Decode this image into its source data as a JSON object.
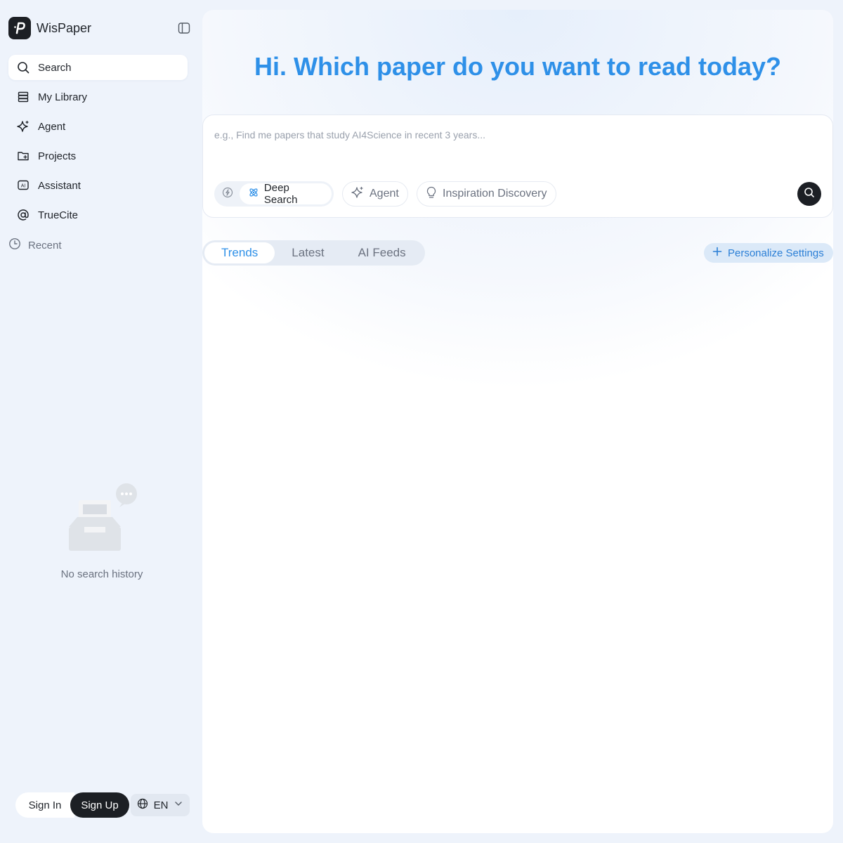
{
  "brand": {
    "name": "WisPaper",
    "logo_letter": "P"
  },
  "sidebar": {
    "items": [
      {
        "label": "Search",
        "icon": "search-icon",
        "active": true
      },
      {
        "label": "My Library",
        "icon": "library-icon"
      },
      {
        "label": "Agent",
        "icon": "sparkle-icon"
      },
      {
        "label": "Projects",
        "icon": "folder-plus-icon"
      },
      {
        "label": "Assistant",
        "icon": "ai-icon"
      },
      {
        "label": "TrueCite",
        "icon": "at-icon"
      }
    ],
    "recent_label": "Recent",
    "empty_text": "No search history"
  },
  "auth": {
    "signin": "Sign In",
    "signup": "Sign Up",
    "language": "EN"
  },
  "main": {
    "headline": "Hi. Which paper do you want to read today?",
    "search": {
      "placeholder": "e.g., Find me papers that study AI4Science in recent 3 years...",
      "value": ""
    },
    "modes": {
      "deep_search": "Deep Search",
      "agent": "Agent",
      "inspiration": "Inspiration Discovery"
    },
    "tabs": [
      "Trends",
      "Latest",
      "AI Feeds"
    ],
    "active_tab": "Trends",
    "personalize": "Personalize Settings"
  },
  "colors": {
    "accent": "#2e90e8",
    "dark": "#1c1f24",
    "sidebar_bg": "#eef3fb"
  }
}
